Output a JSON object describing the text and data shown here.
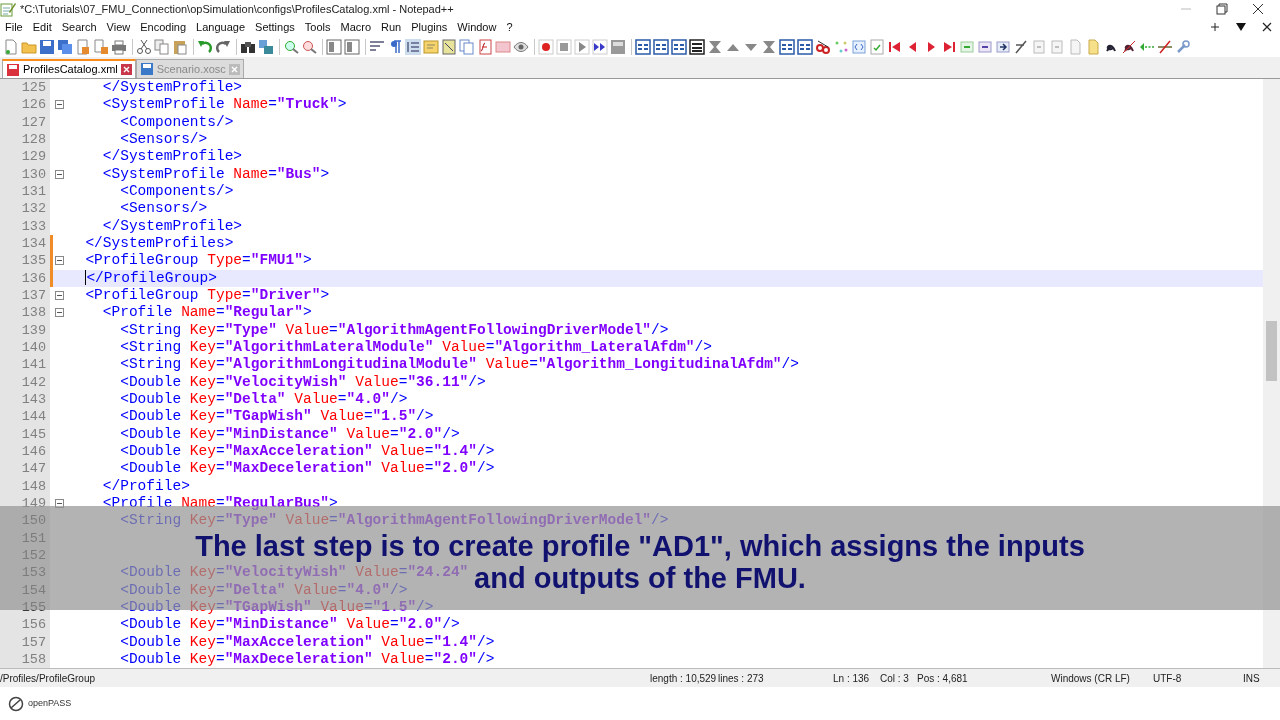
{
  "window": {
    "title": "*C:\\Tutorials\\07_FMU_Connection\\opSimulation\\configs\\ProfilesCatalog.xml - Notepad++"
  },
  "menu": [
    "File",
    "Edit",
    "Search",
    "View",
    "Encoding",
    "Language",
    "Settings",
    "Tools",
    "Macro",
    "Run",
    "Plugins",
    "Window",
    "?"
  ],
  "tabs": [
    {
      "label": "ProfilesCatalog.xml",
      "selected": true,
      "modified": true
    },
    {
      "label": "Scenario.xosc",
      "selected": false,
      "modified": false
    }
  ],
  "editor": {
    "lines": [
      {
        "number": "125",
        "text": "    </SystemProfile>",
        "fold_start": false,
        "modified": false,
        "current": false
      },
      {
        "number": "126",
        "text": "    <SystemProfile Name=\"Truck\">",
        "fold_start": true,
        "modified": false,
        "current": false
      },
      {
        "number": "127",
        "text": "      <Components/>",
        "fold_start": false,
        "modified": false,
        "current": false
      },
      {
        "number": "128",
        "text": "      <Sensors/>",
        "fold_start": false,
        "modified": false,
        "current": false
      },
      {
        "number": "129",
        "text": "    </SystemProfile>",
        "fold_start": false,
        "modified": false,
        "current": false
      },
      {
        "number": "130",
        "text": "    <SystemProfile Name=\"Bus\">",
        "fold_start": true,
        "modified": false,
        "current": false
      },
      {
        "number": "131",
        "text": "      <Components/>",
        "fold_start": false,
        "modified": false,
        "current": false
      },
      {
        "number": "132",
        "text": "      <Sensors/>",
        "fold_start": false,
        "modified": false,
        "current": false
      },
      {
        "number": "133",
        "text": "    </SystemProfile>",
        "fold_start": false,
        "modified": false,
        "current": false
      },
      {
        "number": "134",
        "text": "  </SystemProfiles>",
        "fold_start": false,
        "modified": true,
        "current": false
      },
      {
        "number": "135",
        "text": "  <ProfileGroup Type=\"FMU1\">",
        "fold_start": true,
        "modified": true,
        "current": false
      },
      {
        "number": "136",
        "text": "  </ProfileGroup>",
        "fold_start": false,
        "modified": true,
        "current": true
      },
      {
        "number": "137",
        "text": "  <ProfileGroup Type=\"Driver\">",
        "fold_start": true,
        "modified": false,
        "current": false
      },
      {
        "number": "138",
        "text": "    <Profile Name=\"Regular\">",
        "fold_start": true,
        "modified": false,
        "current": false
      },
      {
        "number": "139",
        "text": "      <String Key=\"Type\" Value=\"AlgorithmAgentFollowingDriverModel\"/>",
        "fold_start": false,
        "modified": false,
        "current": false
      },
      {
        "number": "140",
        "text": "      <String Key=\"AlgorithmLateralModule\" Value=\"Algorithm_LateralAfdm\"/>",
        "fold_start": false,
        "modified": false,
        "current": false
      },
      {
        "number": "141",
        "text": "      <String Key=\"AlgorithmLongitudinalModule\" Value=\"Algorithm_LongitudinalAfdm\"/>",
        "fold_start": false,
        "modified": false,
        "current": false
      },
      {
        "number": "142",
        "text": "      <Double Key=\"VelocityWish\" Value=\"36.11\"/>",
        "fold_start": false,
        "modified": false,
        "current": false
      },
      {
        "number": "143",
        "text": "      <Double Key=\"Delta\" Value=\"4.0\"/>",
        "fold_start": false,
        "modified": false,
        "current": false
      },
      {
        "number": "144",
        "text": "      <Double Key=\"TGapWish\" Value=\"1.5\"/>",
        "fold_start": false,
        "modified": false,
        "current": false
      },
      {
        "number": "145",
        "text": "      <Double Key=\"MinDistance\" Value=\"2.0\"/>",
        "fold_start": false,
        "modified": false,
        "current": false
      },
      {
        "number": "146",
        "text": "      <Double Key=\"MaxAcceleration\" Value=\"1.4\"/>",
        "fold_start": false,
        "modified": false,
        "current": false
      },
      {
        "number": "147",
        "text": "      <Double Key=\"MaxDeceleration\" Value=\"2.0\"/>",
        "fold_start": false,
        "modified": false,
        "current": false
      },
      {
        "number": "148",
        "text": "    </Profile>",
        "fold_start": false,
        "modified": false,
        "current": false
      },
      {
        "number": "149",
        "text": "    <Profile Name=\"RegularBus\">",
        "fold_start": true,
        "modified": false,
        "current": false
      },
      {
        "number": "150",
        "text": "      <String Key=\"Type\" Value=\"AlgorithmAgentFollowingDriverModel\"/>",
        "fold_start": false,
        "modified": false,
        "current": false
      },
      {
        "number": "151",
        "fold_start": false,
        "modified": false
      },
      {
        "number": "152",
        "fold_start": false,
        "modified": false
      },
      {
        "number": "153",
        "text": "      <Double Key=\"VelocityWish\" Value=\"24.24\"",
        "fold_start": false,
        "modified": false,
        "current": false
      },
      {
        "number": "154",
        "text": "      <Double Key=\"Delta\" Value=\"4.0\"/>",
        "fold_start": false,
        "modified": false,
        "current": false
      },
      {
        "number": "155",
        "text": "      <Double Key=\"TGapWish\" Value=\"1.5\"/>",
        "fold_start": false,
        "modified": false,
        "current": false
      },
      {
        "number": "156",
        "text": "      <Double Key=\"MinDistance\" Value=\"2.0\"/>",
        "fold_start": false,
        "modified": false,
        "current": false
      },
      {
        "number": "157",
        "text": "      <Double Key=\"MaxAcceleration\" Value=\"1.4\"/>",
        "fold_start": false,
        "modified": false,
        "current": false
      },
      {
        "number": "158",
        "text": "      <Double Key=\"MaxDeceleration\" Value=\"2.0\"/>",
        "fold_start": false,
        "modified": false,
        "current": false
      }
    ]
  },
  "caption": [
    "The last step is to create profile \"AD1\", which assigns the inputs",
    "and outputs of the FMU."
  ],
  "status_bar": {
    "path": "/Profiles/ProfileGroup",
    "length": "length : 10,529",
    "lines": "lines : 273",
    "ln": "Ln : 136",
    "col": "Col : 3",
    "pos": "Pos : 4,681",
    "eol": "Windows (CR LF)",
    "encoding": "UTF-8",
    "mode": "INS"
  },
  "branding": {
    "label": "openPASS"
  }
}
